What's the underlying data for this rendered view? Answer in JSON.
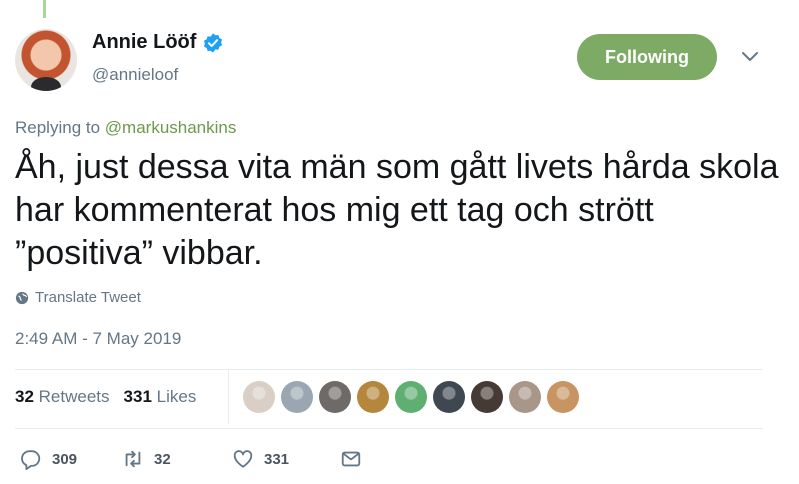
{
  "author": {
    "name": "Annie Lööf",
    "handle": "@annieloof"
  },
  "follow_button": {
    "label": "Following"
  },
  "reply": {
    "prefix": "Replying to ",
    "mention": "@markushankins"
  },
  "tweet": {
    "text": "Åh, just dessa vita män som gått livets hårda skola har kommenterat hos mig ett tag och strött ”positiva” vibbar."
  },
  "translate": {
    "label": "Translate Tweet"
  },
  "timestamp": "2:49 AM - 7 May 2019",
  "stats": {
    "retweets_count": "32",
    "retweets_label": "Retweets",
    "likes_count": "331",
    "likes_label": "Likes"
  },
  "likers": [
    {
      "name": "liker-avatar-1",
      "color": "#d9cfc7"
    },
    {
      "name": "liker-avatar-2",
      "color": "#9aa6b2"
    },
    {
      "name": "liker-avatar-3",
      "color": "#6d6a67"
    },
    {
      "name": "liker-avatar-4",
      "color": "#b5873d"
    },
    {
      "name": "liker-avatar-5",
      "color": "#5fae72"
    },
    {
      "name": "liker-avatar-6",
      "color": "#3f4750"
    },
    {
      "name": "liker-avatar-7",
      "color": "#463a34"
    },
    {
      "name": "liker-avatar-8",
      "color": "#a89688"
    },
    {
      "name": "liker-avatar-9",
      "color": "#c89562"
    }
  ],
  "actions": {
    "reply_count": "309",
    "retweet_count": "32",
    "like_count": "331"
  },
  "colors": {
    "follow_bg": "#7daa65",
    "mention": "#6c9a4c",
    "verified": "#1da1f2"
  }
}
